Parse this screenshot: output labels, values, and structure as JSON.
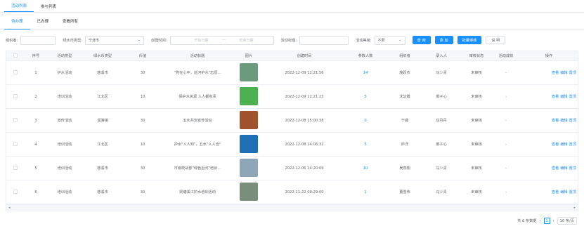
{
  "top_tabs": [
    "活动列表",
    "参与列表"
  ],
  "sub_tabs": [
    "待办理",
    "已办理",
    "查看所有"
  ],
  "filters": {
    "org_label": "组织者:",
    "water_type_label": "绿水币类型:",
    "water_type_value": "宁波市",
    "time_label": "创建时间:",
    "start_placeholder": "开始日期",
    "end_placeholder": "结束日期",
    "range_sep": "—",
    "title_label": "活动标题:",
    "level_label": "活动等级:",
    "level_value": "不限",
    "search_btn": "查 询",
    "add_btn": "添 加",
    "batch_btn": "批量审核",
    "desc_btn": "说 明"
  },
  "columns": [
    "序号",
    "活动类型",
    "绿水币类型",
    "币值",
    "活动标题",
    "图片",
    "创建时间",
    "参数人数",
    "组织者",
    "录入人",
    "审核状态",
    "活动成效",
    "操作"
  ],
  "rows": [
    {
      "no": "1",
      "type": "护水活动",
      "coin": "慈溪市",
      "val": "30",
      "title": "\"党在心中，巡河护水\"志愿...",
      "time": "2022-12-09 12:21:56",
      "count": "14",
      "org": "施跃衣",
      "entry": "马少青",
      "status": "未审核",
      "effect": "-",
      "thumb": "#6b9a7c"
    },
    {
      "no": "2",
      "type": "培训活动",
      "coin": "江北区",
      "val": "10",
      "title": "保护水资源 人人都有责",
      "time": "2022-12-09 12:21:23",
      "count": "5",
      "org": "沈幼霞",
      "entry": "郝子心",
      "status": "未审核",
      "effect": "-",
      "thumb": "#4caf50"
    },
    {
      "no": "3",
      "type": "宣传活动",
      "coin": "溪港镇",
      "val": "30",
      "title": "五水共治宣传活动",
      "time": "2022-12-08 15:00:38",
      "count": "0",
      "org": "于盛",
      "entry": "应丹丹",
      "status": "未审核",
      "effect": "-",
      "thumb": "#a0522d"
    },
    {
      "no": "4",
      "type": "培训活动",
      "coin": "江北区",
      "val": "10",
      "title": "护水\"人人知\"，五水\"人人治\"",
      "time": "2022-12-08 14:06:32",
      "count": "5",
      "org": "庐洋",
      "entry": "郝子心",
      "status": "未审核",
      "effect": "-",
      "thumb": "#1e6fb5"
    },
    {
      "no": "5",
      "type": "培训活动",
      "coin": "慈溪市",
      "val": "30",
      "title": "市级统战部\"绿色后河\"培训...",
      "time": "2022-12-06 14:20:09",
      "count": "10",
      "org": "吴燕翔",
      "entry": "马少青",
      "status": "未审核",
      "effect": "-",
      "thumb": "#8fa6b8"
    },
    {
      "no": "6",
      "type": "培训活动",
      "coin": "慈溪市",
      "val": "30",
      "title": "梁塘溪江护水培训活动",
      "time": "2022-11-22 09:29:00",
      "count": "1",
      "org": "董雪伟",
      "entry": "马少青",
      "status": "未审核",
      "effect": "-",
      "thumb": "#7a8e7c"
    }
  ],
  "ops": [
    "查看",
    "编辑",
    "置顶"
  ],
  "pager": {
    "total": "共 6 条数据",
    "page": "1",
    "size": "10 条/页"
  },
  "scroll_left": "◂",
  "scroll_right": "▸"
}
